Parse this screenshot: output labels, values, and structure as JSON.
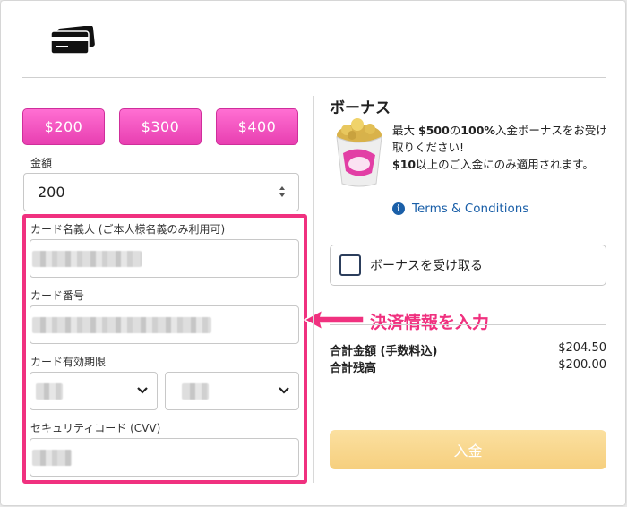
{
  "header": {
    "icon": "credit-card-icon"
  },
  "amounts": [
    "$200",
    "$300",
    "$400"
  ],
  "amount_field": {
    "label": "金額",
    "value": "200"
  },
  "card_form": {
    "holder_label": "カード名義人 (ご本人様名義のみ利用可)",
    "number_label": "カード番号",
    "expiry_label": "カード有効期限",
    "cvv_label": "セキュリティコード (CVV)"
  },
  "annotation": {
    "text": "決済情報を入力",
    "color": "#f0317f"
  },
  "bonus": {
    "title": "ボーナス",
    "image": "vera-john-bucket-icon",
    "desc_1": "最大 ",
    "desc_1b": "$500",
    "desc_2": "の",
    "desc_2b": "100%",
    "desc_3": "入金ボーナスをお受け取りください!",
    "desc_4b": "$10",
    "desc_4": "以上のご入金にのみ適用されます。",
    "terms": "Terms & Conditions",
    "checkbox_label": "ボーナスを受け取る"
  },
  "summary": {
    "total_label": "合計金額 (手数料込)",
    "total_value": "$204.50",
    "balance_label": "合計残高",
    "balance_value": "$200.00"
  },
  "deposit_button": "入金",
  "colors": {
    "accent": "#e83fb1",
    "link": "#1a5fa8",
    "deposit": "#f6cf7e"
  }
}
